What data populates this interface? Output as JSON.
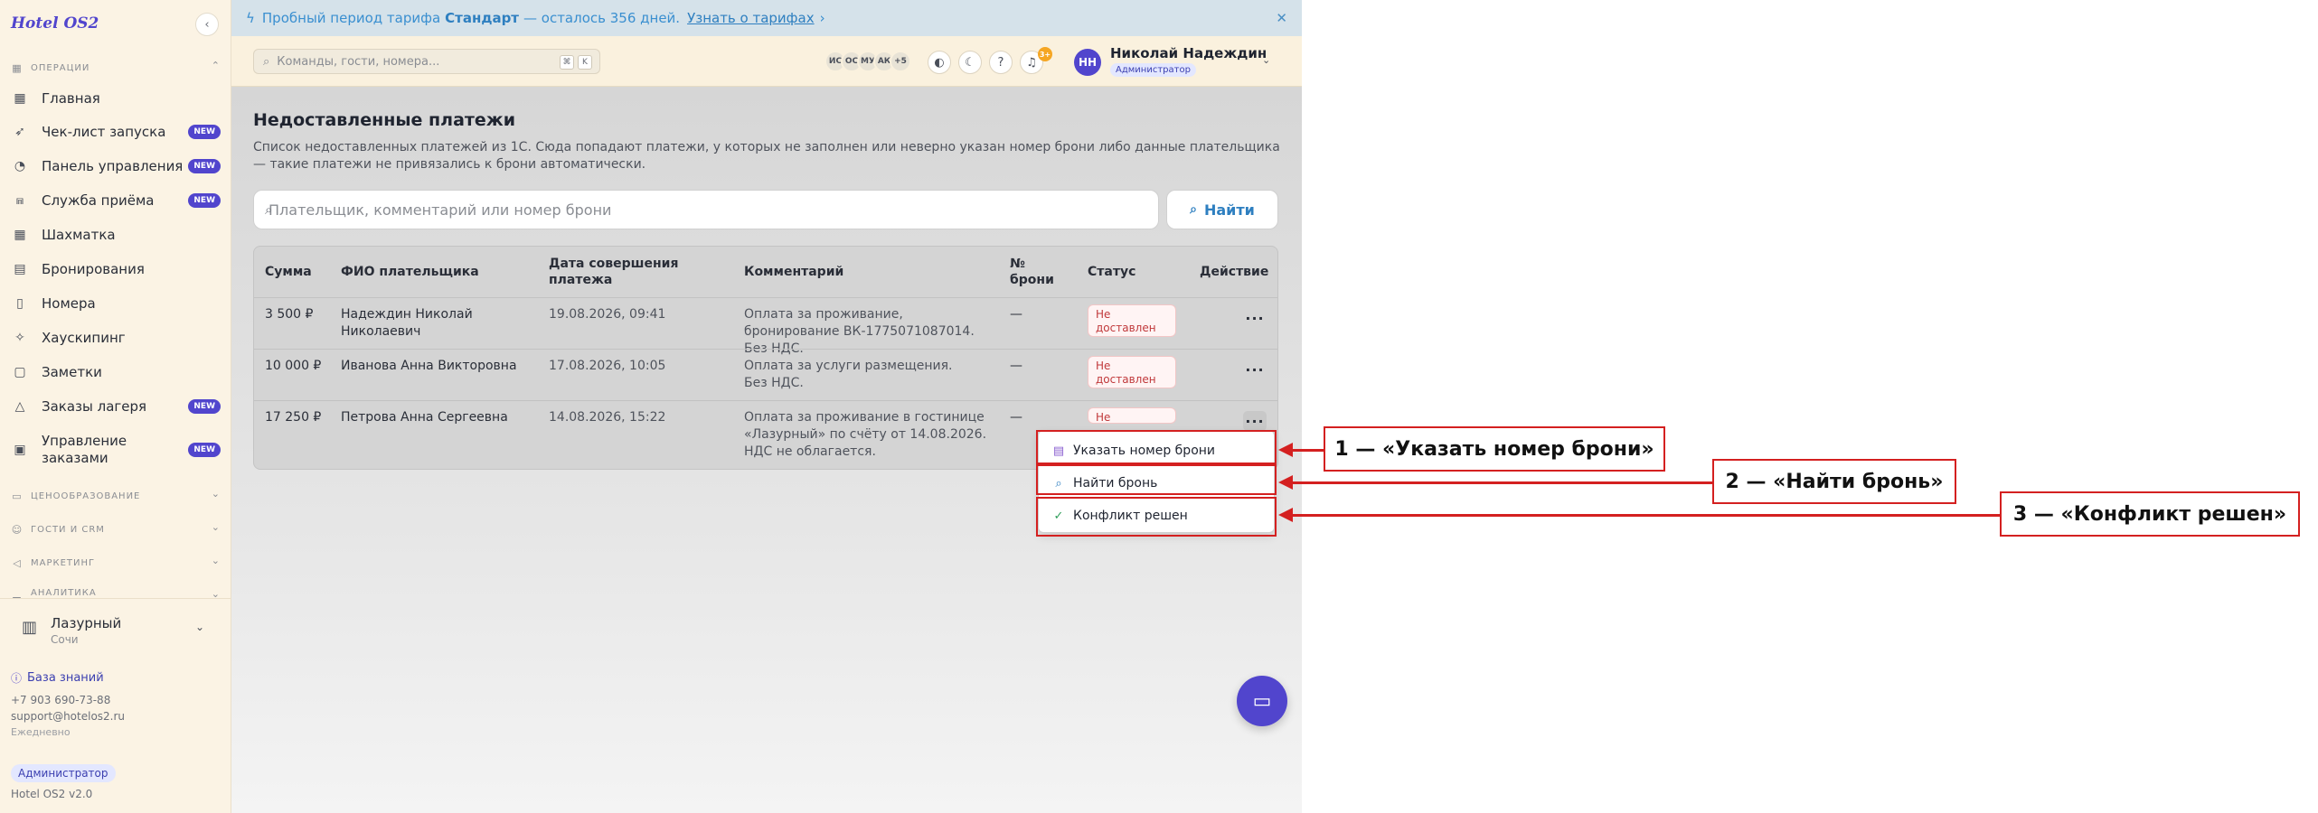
{
  "app": {
    "brand": "Hotel OS2"
  },
  "sidebar": {
    "sections": [
      {
        "label": "Операции",
        "icon": "grid-icon"
      },
      {
        "label": "Ценообразование",
        "icon": "tag-icon"
      },
      {
        "label": "Гости и CRM",
        "icon": "users-icon"
      },
      {
        "label": "Маркетинг",
        "icon": "megaphone-icon"
      },
      {
        "label": "Аналитика",
        "icon": "chart-icon"
      }
    ],
    "items": [
      {
        "label": "Главная",
        "icon": "dashboard-icon",
        "badge": ""
      },
      {
        "label": "Чек-лист запуска",
        "icon": "rocket-icon",
        "badge": "NEW"
      },
      {
        "label": "Панель управления",
        "icon": "gauge-icon",
        "badge": "NEW"
      },
      {
        "label": "Служба приёма",
        "icon": "bell-icon",
        "badge": "NEW"
      },
      {
        "label": "Шахматка",
        "icon": "table-grid-icon",
        "badge": ""
      },
      {
        "label": "Бронирования",
        "icon": "clipboard-icon",
        "badge": ""
      },
      {
        "label": "Номера",
        "icon": "building-icon",
        "badge": ""
      },
      {
        "label": "Хаускипинг",
        "icon": "sparkle-icon",
        "badge": ""
      },
      {
        "label": "Заметки",
        "icon": "note-icon",
        "badge": ""
      },
      {
        "label": "Заказы лагеря",
        "icon": "tent-icon",
        "badge": "NEW"
      },
      {
        "label": "Управление заказами",
        "icon": "orders-icon",
        "badge": "NEW"
      }
    ],
    "hotel": {
      "name": "Лазурный",
      "city": "Сочи"
    },
    "knowledge_base": "База знаний",
    "phone": "+7 903 690-73-88",
    "email": "support@hotelos2.ru",
    "schedule": "Ежедневно",
    "role": "Администратор",
    "version": "Hotel OS2 v2.0"
  },
  "banner": {
    "text_before": "Пробный период тарифа",
    "plan": "Стандарт",
    "text_after": "— осталось 356 дней.",
    "link": "Узнать о тарифах",
    "arrow": "›",
    "close": "✕"
  },
  "topbar": {
    "search_placeholder": "Команды, гости, номера...",
    "kbd": [
      "⌘",
      "K"
    ],
    "avatars": [
      "ИС",
      "ОС",
      "МУ",
      "АК",
      "+5"
    ],
    "notifications": "3+",
    "user": {
      "initials": "НН",
      "name": "Николай Надеждин",
      "role": "Администратор"
    }
  },
  "page": {
    "title": "Недоставленные платежи",
    "description": "Список недоставленных платежей из 1С. Сюда попадают платежи, у которых не заполнен или неверно указан номер брони либо данные плательщика — такие платежи не привязались к брони автоматически.",
    "search_placeholder": "Плательщик, комментарий или номер брони",
    "find_label": "Найти"
  },
  "table": {
    "headers": [
      "Сумма",
      "ФИО плательщика",
      "Дата совершения платежа",
      "Комментарий",
      "№ брони",
      "Статус",
      "Действие"
    ],
    "rows": [
      {
        "amount": "3 500 ₽",
        "payer": "Надеждин Николай Николаевич",
        "date": "19.08.2026, 09:41",
        "comment": "Оплата за проживание, бронирование ВК-1775071087014. Без НДС.",
        "booking": "—",
        "status": "Не доставлен"
      },
      {
        "amount": "10 000 ₽",
        "payer": "Иванова Анна Викторовна",
        "date": "17.08.2026, 10:05",
        "comment": "Оплата за услуги размещения. Без НДС.",
        "booking": "—",
        "status": "Не доставлен"
      },
      {
        "amount": "17 250 ₽",
        "payer": "Петрова Анна Сергеевна",
        "date": "14.08.2026, 15:22",
        "comment": "Оплата за проживание в гостинице «Лазурный» по счёту от 14.08.2026. НДС не облагается.",
        "booking": "—",
        "status": "Не доставлен"
      }
    ],
    "action_label": "···"
  },
  "menu": {
    "items": [
      {
        "label": "Указать номер брони",
        "icon": "document-icon"
      },
      {
        "label": "Найти бронь",
        "icon": "search-icon"
      },
      {
        "label": "Конфликт решен",
        "icon": "check-circle-icon"
      }
    ]
  },
  "annotations": [
    "1 — «Указать номер брони»",
    "2 — «Найти бронь»",
    "3 — «Конфликт решен»"
  ],
  "colors": {
    "accent": "#5145cd",
    "annotation": "#d42020",
    "status_error": "#c0393b",
    "sidebar_bg": "#fbf3e4"
  }
}
